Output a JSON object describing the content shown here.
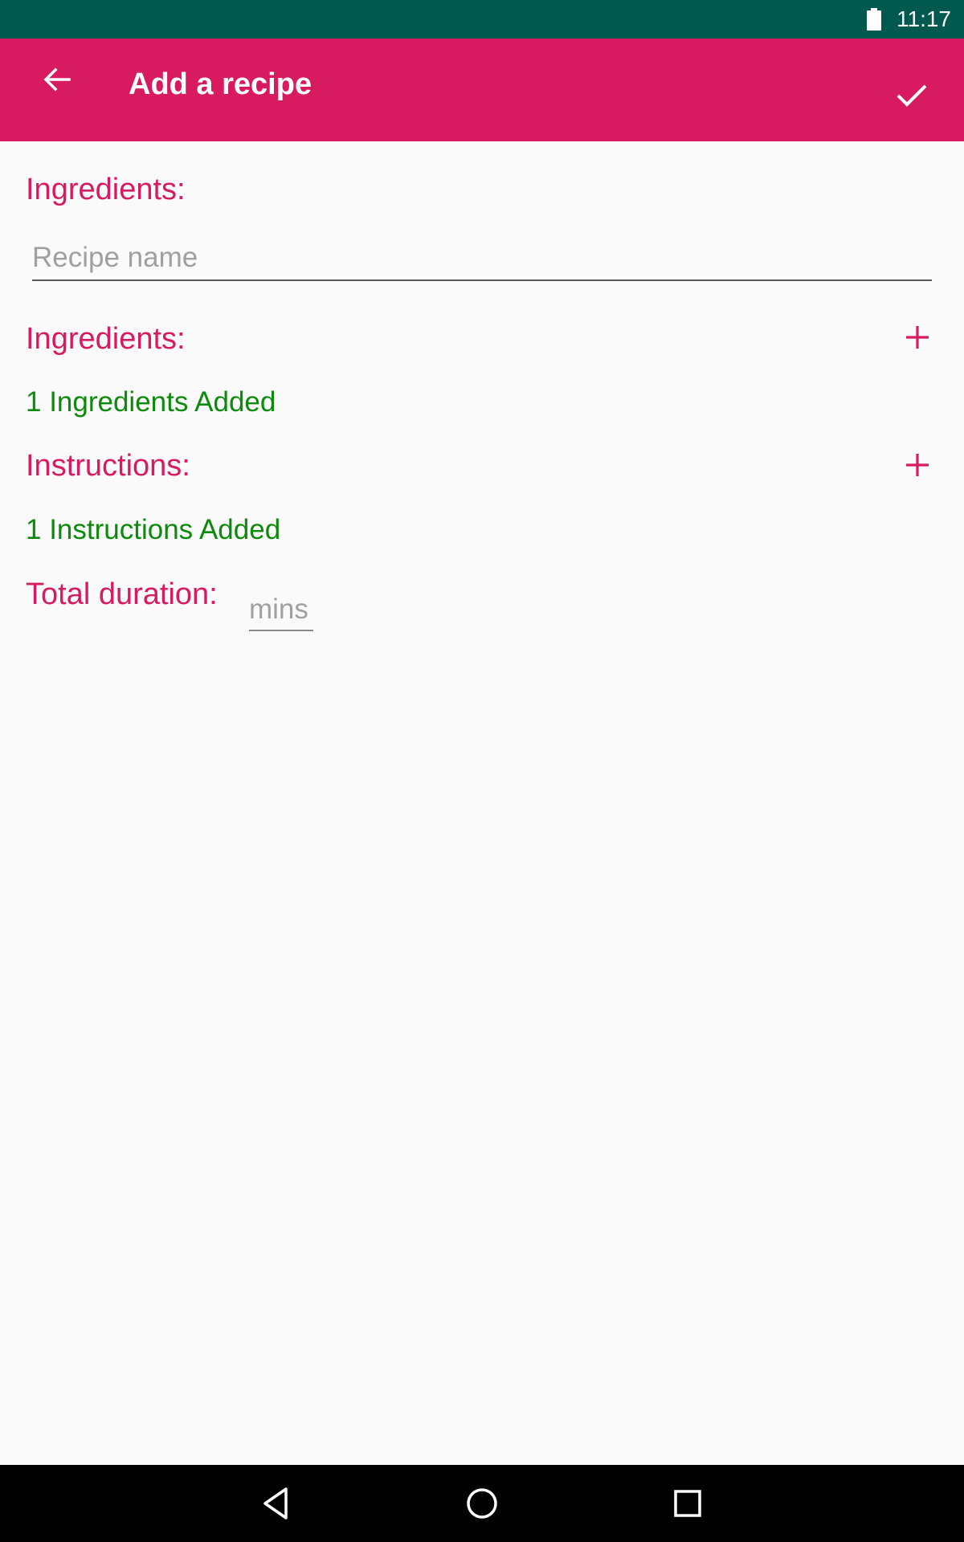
{
  "status_bar": {
    "time": "11:17",
    "battery_icon": "battery-full-icon"
  },
  "app_bar": {
    "title": "Add a recipe",
    "back_icon": "arrow-back-icon",
    "done_icon": "check-icon",
    "background": "#d81b60"
  },
  "form": {
    "name_section_label": "Ingredients:",
    "recipe_name_placeholder": "Recipe name",
    "recipe_name_value": "",
    "ingredients_label": "Ingredients:",
    "ingredients_status": "1 Ingredients Added",
    "instructions_label": "Instructions:",
    "instructions_status": "1 Instructions Added",
    "duration_label": "Total duration:",
    "duration_placeholder": "mins",
    "duration_value": "",
    "add_icon": "plus-icon"
  },
  "nav_bar": {
    "back_icon": "nav-back-triangle-icon",
    "home_icon": "nav-home-circle-icon",
    "recents_icon": "nav-recents-square-icon"
  },
  "colors": {
    "status_bar": "#00594f",
    "accent": "#d81b60",
    "success_text": "#0b8a0b",
    "background": "#fafafa"
  }
}
